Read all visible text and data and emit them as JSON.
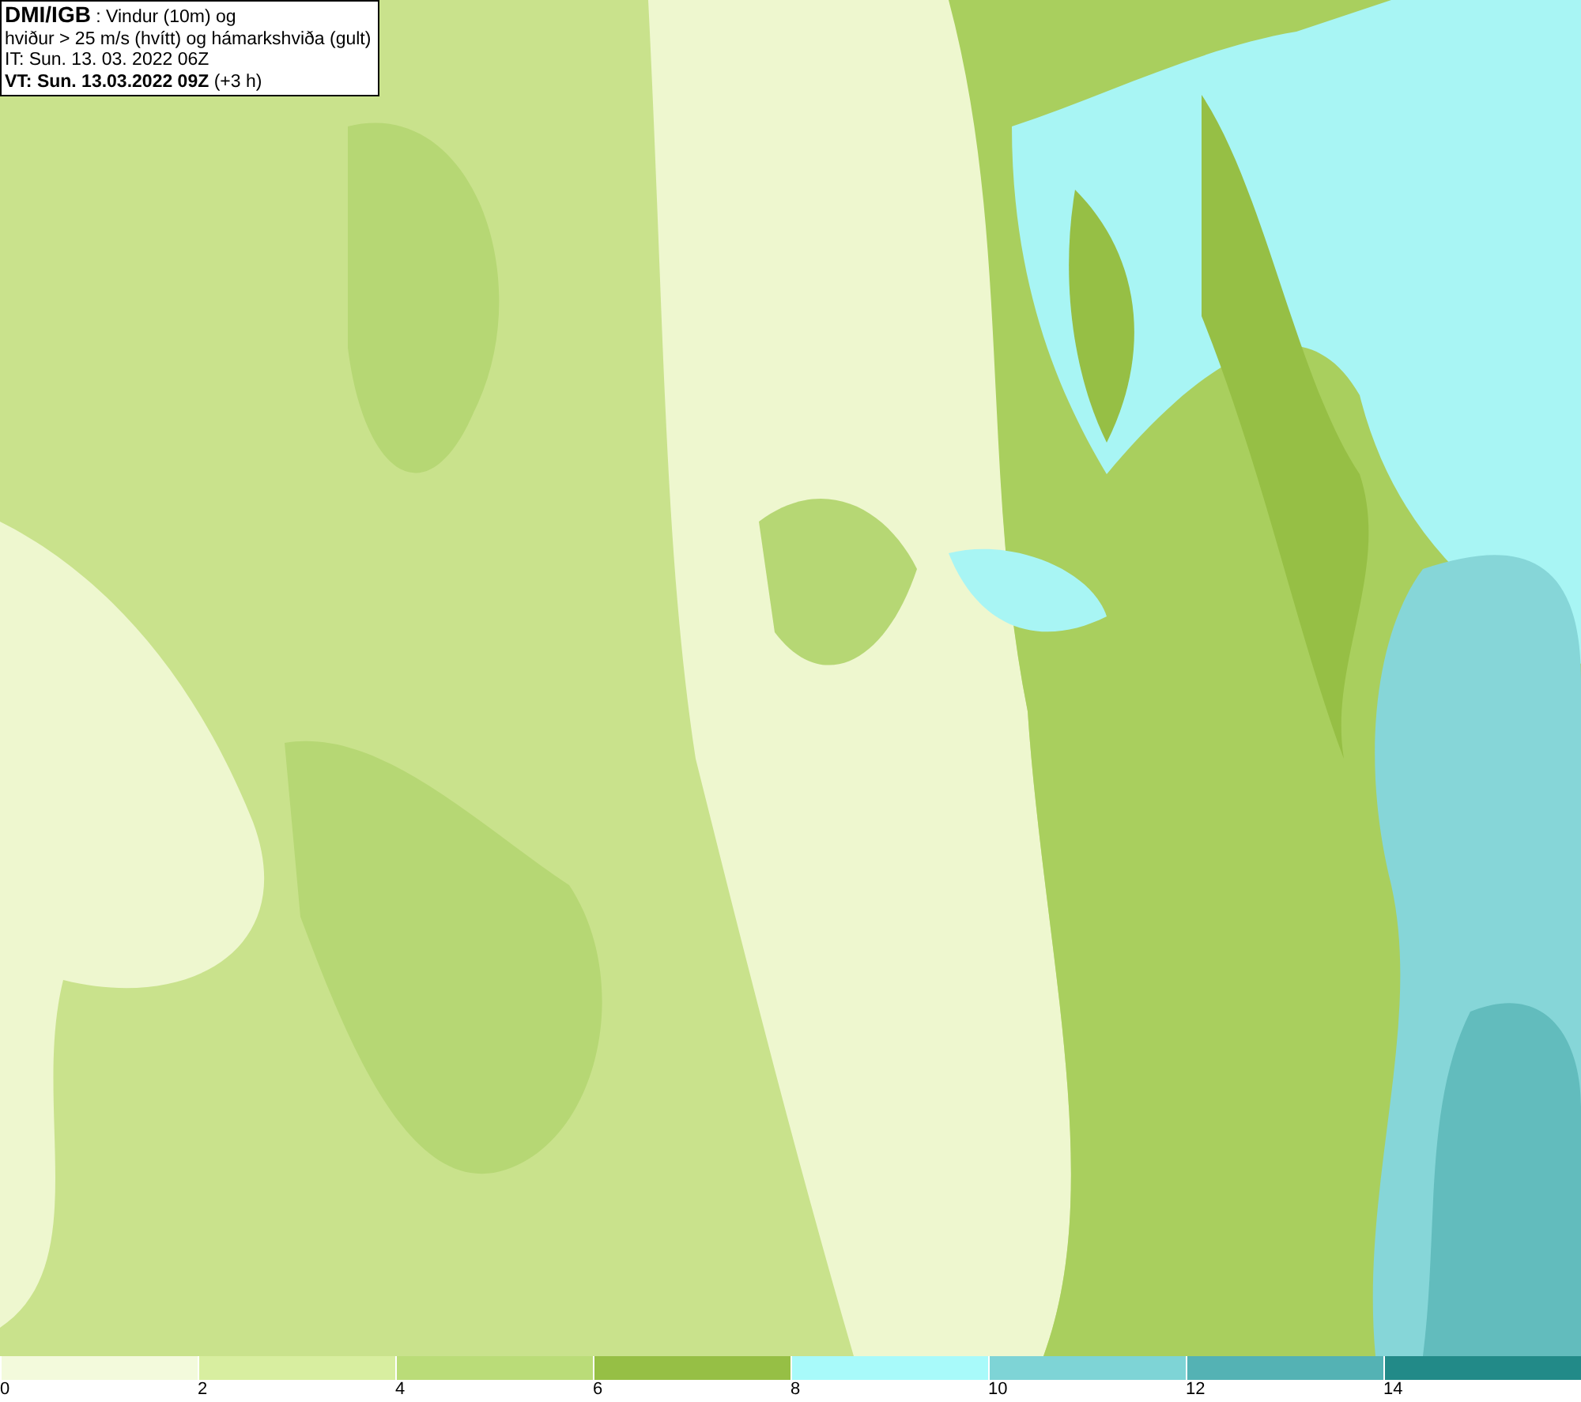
{
  "info_box": {
    "lines": [
      "**DMI/IGB** : Vindur (10m) og",
      "hviður > 25 m/s (hvítt) og hámarkshviða (gult)",
      "IT: Sun. 13. 03. 2022 06Z",
      "**VT: Sun. 13.03.2022 09Z** (+3 h)"
    ]
  },
  "legend": {
    "bins": [
      {
        "label": "0",
        "color": "#f3fadc"
      },
      {
        "label": "2",
        "color": "#d8eea0"
      },
      {
        "label": "4",
        "color": "#badc78"
      },
      {
        "label": "6",
        "color": "#96bf45"
      },
      {
        "label": "8",
        "color": "#a8fafa"
      },
      {
        "label": "10",
        "color": "#7ed4d6"
      },
      {
        "label": "12",
        "color": "#54b2b4"
      },
      {
        "label": "14",
        "color": "#228a88"
      }
    ]
  }
}
